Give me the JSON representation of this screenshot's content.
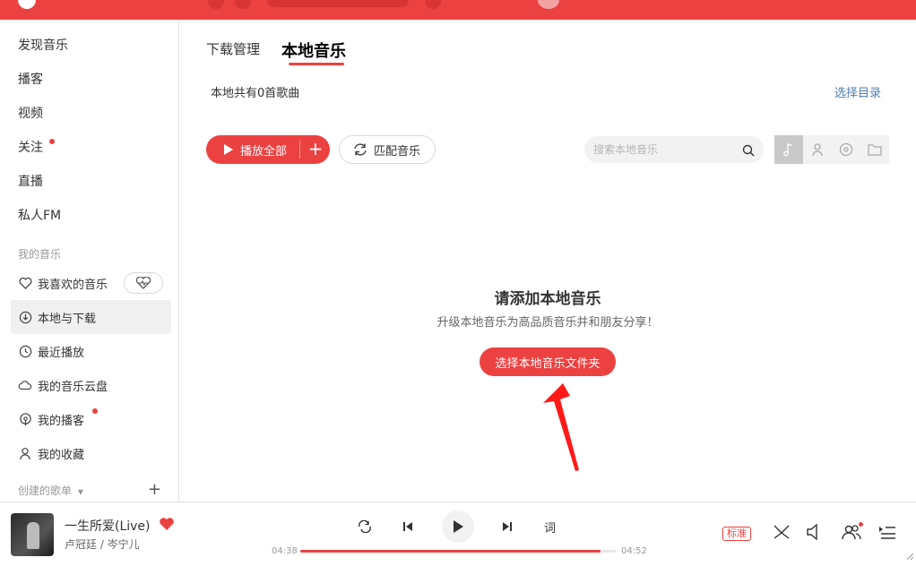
{
  "sidebar": {
    "nav": [
      "发现音乐",
      "播客",
      "视频",
      "关注",
      "直播",
      "私人FM"
    ],
    "my_music_title": "我的音乐",
    "my_music": [
      "我喜欢的音乐",
      "本地与下载",
      "最近播放",
      "我的音乐云盘",
      "我的播客",
      "我的收藏"
    ],
    "created_playlists": "创建的歌单"
  },
  "main": {
    "tabs": [
      "下载管理",
      "本地音乐"
    ],
    "active_tab": "本地音乐",
    "count_text": "本地共有0首歌曲",
    "choose_dir": "选择目录",
    "play_all": "播放全部",
    "match": "匹配音乐",
    "search_placeholder": "搜索本地音乐",
    "empty": {
      "title": "请添加本地音乐",
      "subtitle": "升级本地音乐为高品质音乐并和朋友分享！",
      "button": "选择本地音乐文件夹"
    }
  },
  "player": {
    "song": "一生所爱(Live)",
    "artist": "卢冠廷 / 岑宁儿",
    "lyric_label": "词",
    "current_time": "04:38",
    "total_time": "04:52",
    "progress": 0.952,
    "quality": "标准"
  },
  "colors": {
    "accent": "#ec4141",
    "link": "#507daf"
  }
}
